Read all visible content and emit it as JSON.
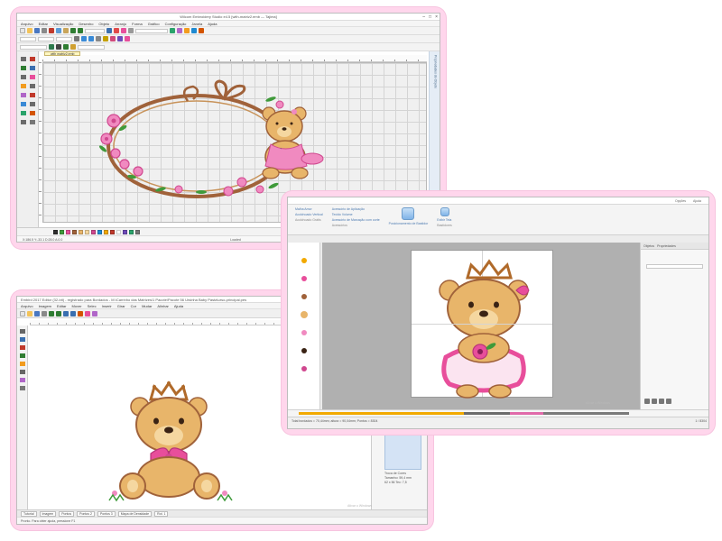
{
  "colors": {
    "frame_pink": "#ffd6ec",
    "embroidery_pink": "#e84e9b",
    "bear_tan": "#e8b56a",
    "frame_brown": "#a0623a",
    "leaf_green": "#3f9a3a",
    "crown_brown": "#b06a2a"
  },
  "window1": {
    "title": "Wilcom Embroidery Studio e4.5 [with-matriz2.emb — Tajima]",
    "menu": [
      "Arquivo",
      "Editar",
      "Visualização",
      "Desenho",
      "Objeto",
      "Arranjo",
      "Forma",
      "Gráfico",
      "Configuração",
      "Janela",
      "Ajuda"
    ],
    "canvas_tab": "with matriz2.emb",
    "side_panel_label": "Propriedades do Objeto",
    "status_left": "X:186.5  Y:-33.1  D:28.0  A:0.0",
    "status_center": "Loaded",
    "status_right": "EMPHI / 801 / 1163",
    "watermark": [
      "Ativar o Windows",
      "Acesse Configurações para ativar o Windows."
    ],
    "icons": [
      "new-icon",
      "open-icon",
      "save-icon",
      "print-icon",
      "undo-icon",
      "redo-icon",
      "zoom-icon",
      "stitch-icon"
    ]
  },
  "window2": {
    "ribbon_tabs": [
      "Opções",
      "Ajuda"
    ],
    "ribbon_groups": [
      {
        "label": "Acolchoado Grátis",
        "items": [
          "Malha Amor",
          "Acolchoado Vertical"
        ]
      },
      {
        "label": "Acessórios",
        "items": [
          "Acessório de Aplicação",
          "Tecido Volume",
          "Acessório de Marcação com corte"
        ]
      },
      {
        "label": "Posicionamento de Bastidor",
        "items": []
      },
      {
        "label": "Bastidores",
        "items": [
          "Exibir Tela"
        ]
      }
    ],
    "panel_tabs": [
      "Objetos",
      "Propriedades"
    ],
    "timeline_values": [
      "1",
      "8304"
    ],
    "status_text": "Total bordados = 70,44mm; altura = 90,04mm; Pontos = 8304",
    "watermark": [
      "Ativar o Windows"
    ]
  },
  "window3": {
    "title": "Embird 2017 Editor (32-bit) - registrado para Bordados - M:\\Carrinho das Matrizes\\1 Pacote\\Pacote 56 Ursinha Baby Pasta\\urso-principal.pes",
    "menu": [
      "Arquivo",
      "Imagem",
      "Editar",
      "Mover",
      "Selec",
      "Inserir",
      "Girar",
      "Cor",
      "Mudar",
      "Alinhar",
      "Ajuda"
    ],
    "tabs": [
      "Tutorial",
      "Imagem",
      "Pontos",
      "Pontos 2",
      "Pontos 3",
      "Mapa de Densidade",
      "Rot. 1"
    ],
    "status_text": "Pronto. Para obter ajuda, pressione F1",
    "info_panel": [
      "Troca de Cores",
      "Tamanho: 59,4 mm",
      "62 x 56 Tec: 7,5"
    ],
    "watermark": [
      "Ativar o Windows"
    ]
  }
}
